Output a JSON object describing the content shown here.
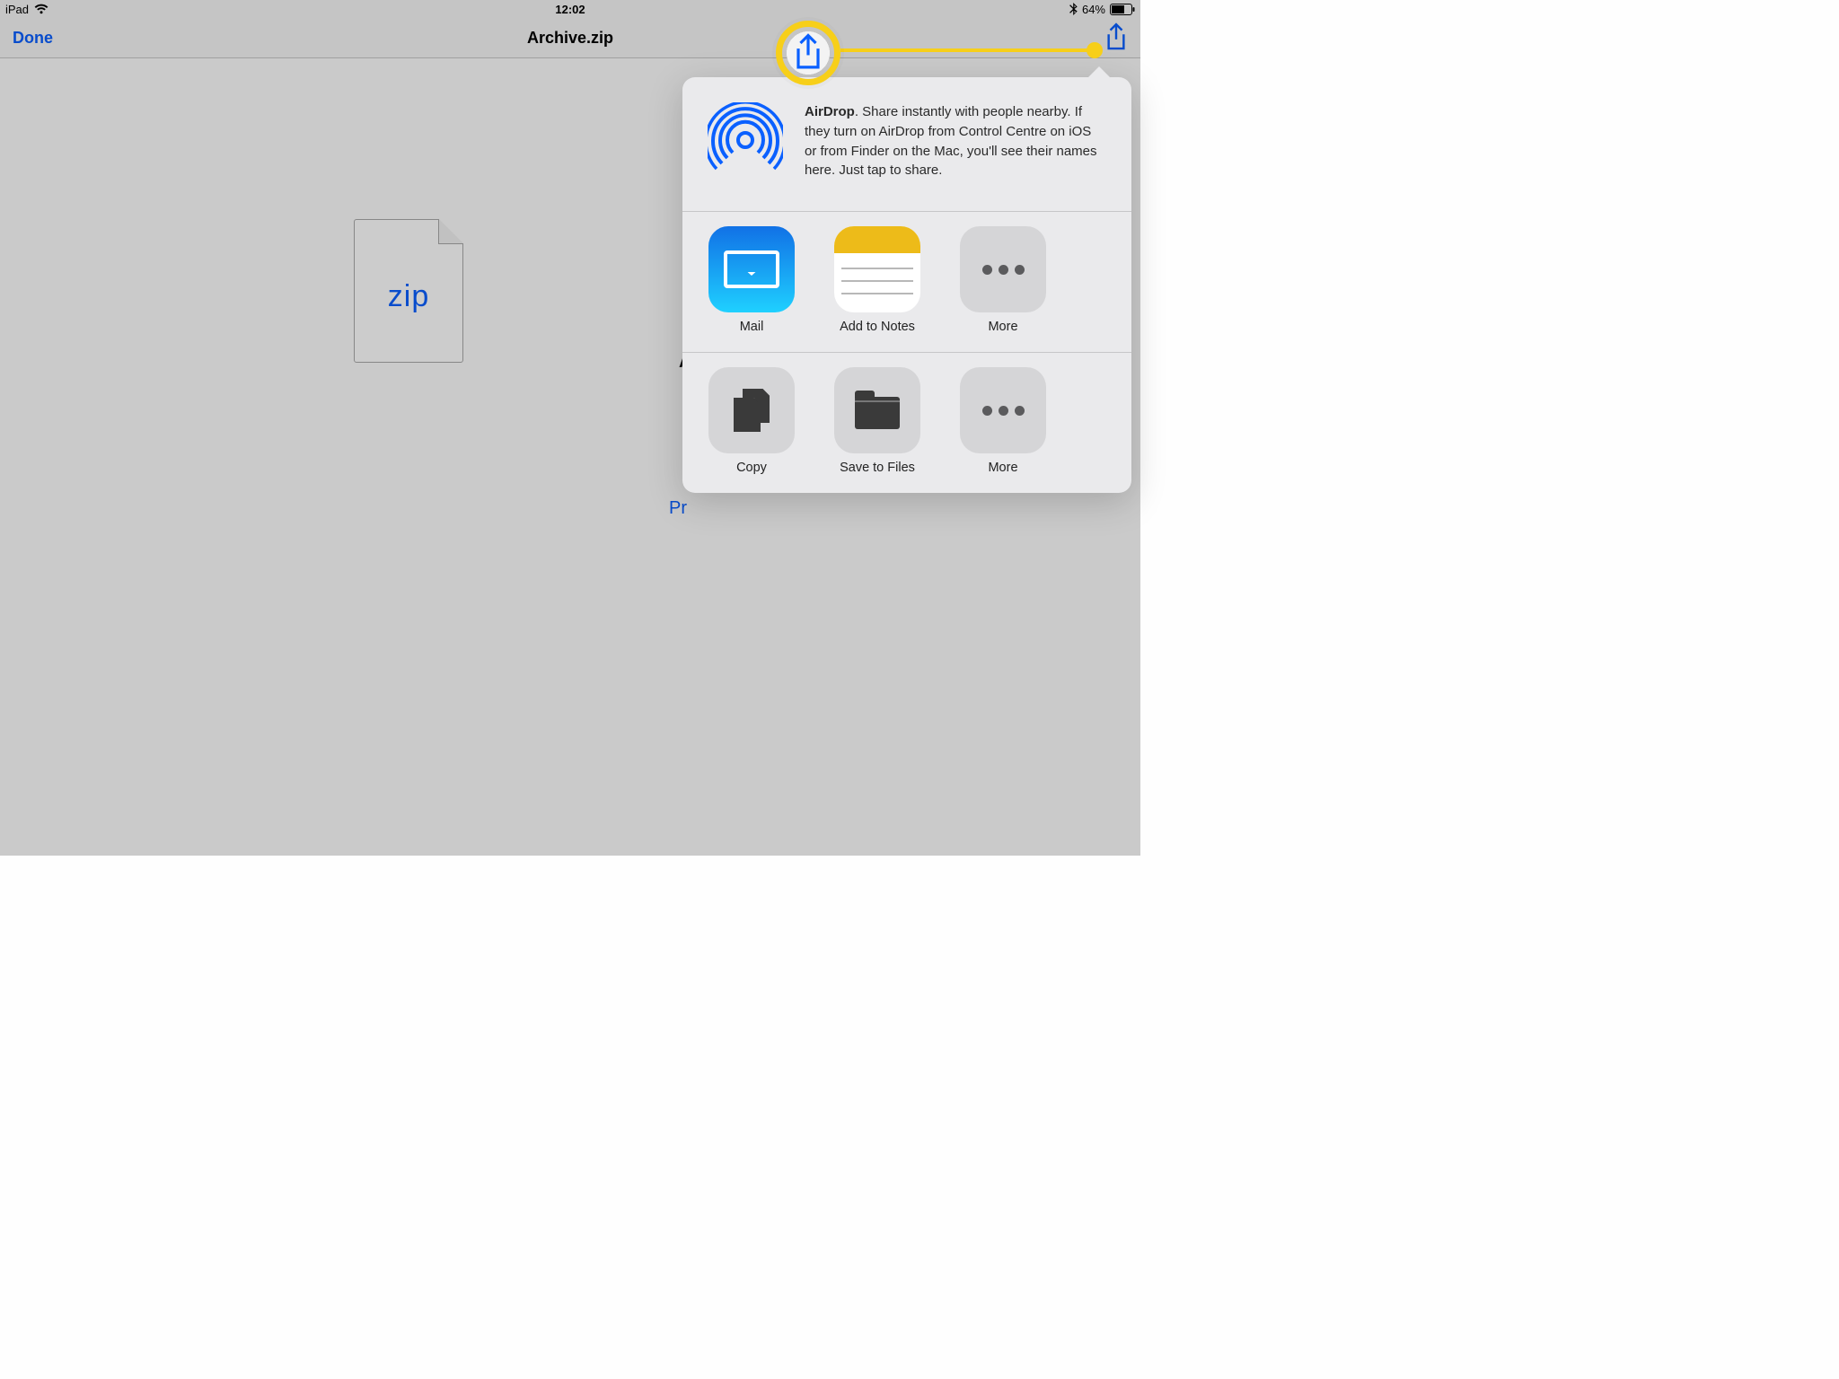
{
  "status": {
    "device": "iPad",
    "time": "12:02",
    "battery_pct": "64%"
  },
  "nav": {
    "done_label": "Done",
    "title": "Archive.zip"
  },
  "file": {
    "type_label": "zip"
  },
  "background_hidden": {
    "text1": "A",
    "text2": "Pr"
  },
  "airdrop": {
    "title": "AirDrop",
    "body": ". Share instantly with people nearby. If they turn on AirDrop from Control Centre on iOS or from Finder on the Mac, you'll see their names here. Just tap to share."
  },
  "app_row": [
    {
      "id": "mail",
      "label": "Mail"
    },
    {
      "id": "notes",
      "label": "Add to Notes"
    },
    {
      "id": "more-apps",
      "label": "More"
    }
  ],
  "action_row": [
    {
      "id": "copy",
      "label": "Copy"
    },
    {
      "id": "save-files",
      "label": "Save to Files"
    },
    {
      "id": "more-actions",
      "label": "More"
    }
  ],
  "colors": {
    "ios_blue": "#0a60ff",
    "callout_yellow": "#f7cf19"
  }
}
